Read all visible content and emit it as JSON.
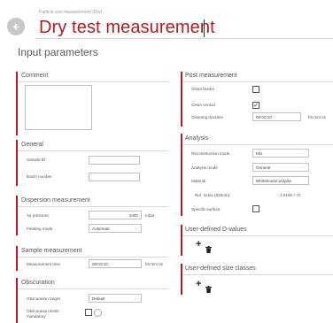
{
  "header": {
    "subtitle": "Particle size measurement (Dry)",
    "title": "Dry test measurement",
    "section": "Input parameters"
  },
  "comment": {
    "title": "Comment",
    "value": ""
  },
  "general": {
    "title": "General",
    "sample_id_label": "Sample ID",
    "sample_id_value": "",
    "batch_label": "Batch number",
    "batch_value": ""
  },
  "dispersion": {
    "title": "Dispersion measurement",
    "air_label": "Air pressure",
    "air_value": "1000",
    "air_unit": "mbar",
    "feeding_label": "Feeding mode",
    "feeding_value": "Automatic"
  },
  "sample": {
    "title": "Sample measurement",
    "time_label": "Measurement time",
    "time_value": "00:03:10",
    "time_unit": "hh:mm:ss"
  },
  "obscuration": {
    "title": "Obscuration",
    "target_label": "Obscuration target",
    "target_value": "Default",
    "limits_label": "Obscuration limits mandatory"
  },
  "post": {
    "title": "Post measurement",
    "clean_feeder_label": "Clean feeder",
    "clean_feeder_checked": false,
    "clean_venturi_label": "Clean venturi",
    "clean_venturi_checked": true,
    "check_mark": "✓",
    "duration_label": "Cleaning duration",
    "duration_value": "00:00:10",
    "duration_unit": "hh:mm:ss"
  },
  "analysis": {
    "title": "Analysis",
    "recon_label": "Reconstruction mode",
    "recon_value": "Mix",
    "mode_label": "Analysis mode",
    "mode_value": "General",
    "material_label": "Material",
    "material_value": "Whitehouse polydis",
    "refidx_label": "Ref. index (830nm)",
    "refidx_value": "1.5165 + 0i",
    "surface_label": "Specific surface"
  },
  "dvalues": {
    "title": "User-defined D-values",
    "add": "+",
    "delete_icon": "trash-icon"
  },
  "sizeclasses": {
    "title": "User-defined size classes",
    "add": "+",
    "delete_icon": "trash-icon"
  },
  "icons": {
    "back": "back-arrow-icon",
    "chevron": "chevron-down-icon"
  }
}
